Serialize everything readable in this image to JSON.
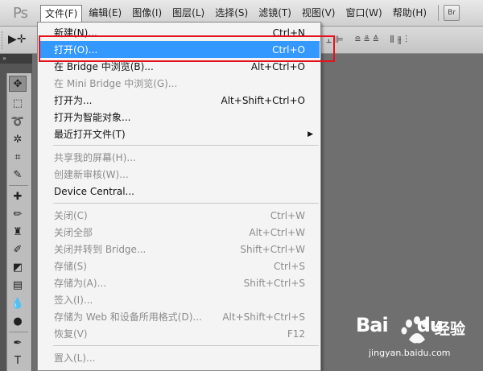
{
  "app": {
    "logo": "Ps"
  },
  "menubar": {
    "items": [
      {
        "label": "文件(F)"
      },
      {
        "label": "编辑(E)"
      },
      {
        "label": "图像(I)"
      },
      {
        "label": "图层(L)"
      },
      {
        "label": "选择(S)"
      },
      {
        "label": "滤镜(T)"
      },
      {
        "label": "视图(V)"
      },
      {
        "label": "窗口(W)"
      },
      {
        "label": "帮助(H)"
      }
    ],
    "bridge_button": "Br"
  },
  "options": {
    "tool_glyph": "▶✛"
  },
  "tools_panel": {
    "header": "»"
  },
  "file_menu": {
    "items": [
      {
        "label": "新建(N)...",
        "shortcut": "Ctrl+N"
      },
      {
        "label": "打开(O)...",
        "shortcut": "Ctrl+O"
      },
      {
        "label": "在 Bridge 中浏览(B)...",
        "shortcut": "Alt+Ctrl+O"
      },
      {
        "label": "在 Mini Bridge 中浏览(G)...",
        "shortcut": ""
      },
      {
        "label": "打开为...",
        "shortcut": "Alt+Shift+Ctrl+O"
      },
      {
        "label": "打开为智能对象...",
        "shortcut": ""
      },
      {
        "label": "最近打开文件(T)",
        "shortcut": ""
      },
      {
        "label": "共享我的屏幕(H)...",
        "shortcut": ""
      },
      {
        "label": "创建新审核(W)...",
        "shortcut": ""
      },
      {
        "label": "Device Central...",
        "shortcut": ""
      },
      {
        "label": "关闭(C)",
        "shortcut": "Ctrl+W"
      },
      {
        "label": "关闭全部",
        "shortcut": "Alt+Ctrl+W"
      },
      {
        "label": "关闭并转到 Bridge...",
        "shortcut": "Shift+Ctrl+W"
      },
      {
        "label": "存储(S)",
        "shortcut": "Ctrl+S"
      },
      {
        "label": "存储为(A)...",
        "shortcut": "Shift+Ctrl+S"
      },
      {
        "label": "签入(I)...",
        "shortcut": ""
      },
      {
        "label": "存储为 Web 和设备所用格式(D)...",
        "shortcut": "Alt+Shift+Ctrl+S"
      },
      {
        "label": "恢复(V)",
        "shortcut": "F12"
      },
      {
        "label": "置入(L)...",
        "shortcut": ""
      }
    ],
    "highlight_color": "#3398ff",
    "annotation_color": "#e3121e"
  },
  "watermark": {
    "brand": "Bai",
    "brand_suffix": "du",
    "cn": "经验",
    "url": "jingyan.baidu.com"
  }
}
